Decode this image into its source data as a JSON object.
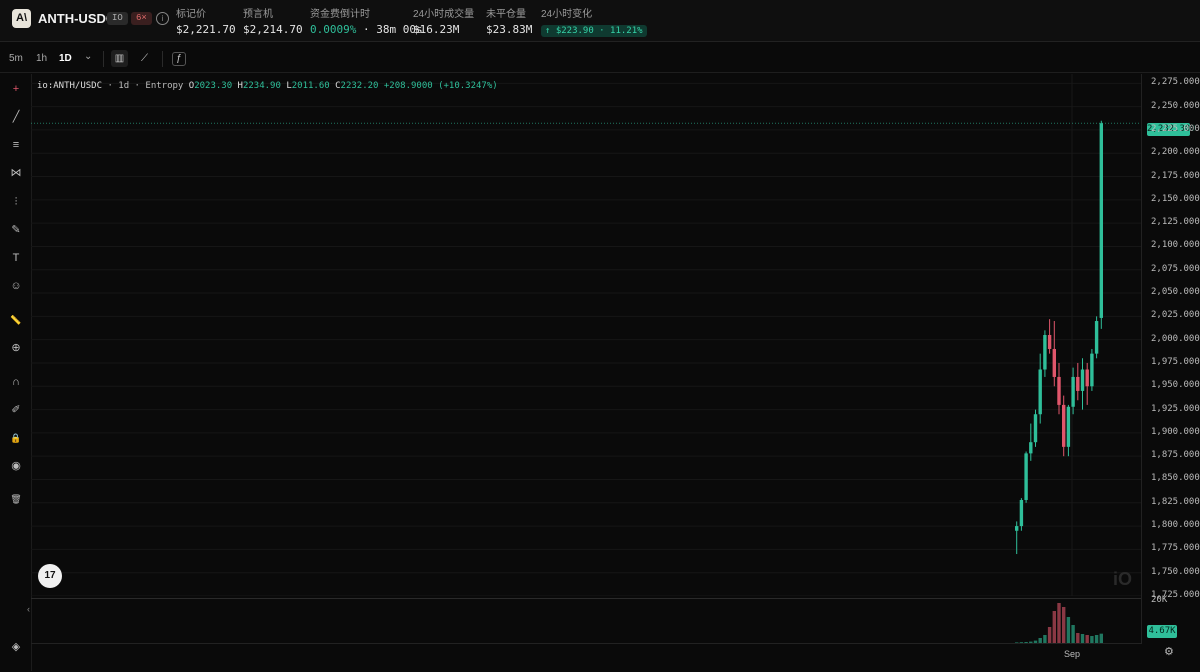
{
  "header": {
    "logo_text": "A\\",
    "pair": "ANTH-USDC",
    "venue_badge": "IO",
    "leverage_badge": "6×",
    "info_glyph": "i",
    "stats": [
      {
        "label": "标记价",
        "value": "$2,221.70"
      },
      {
        "label": "预言机",
        "value": "$2,214.70"
      },
      {
        "label": "资金费倒计时",
        "value_rate": "0.0009%",
        "value_sep": " · ",
        "value_timer": "38m 00s"
      },
      {
        "label": "24小时成交量",
        "value": "$16.23M"
      },
      {
        "label": "未平仓量",
        "value": "$23.83M"
      },
      {
        "label": "24小时变化",
        "value": "↑ $223.90 · 11.21%"
      }
    ]
  },
  "toolbar": {
    "timeframes": [
      "5m",
      "1h",
      "1D"
    ],
    "active_timeframe": "1D",
    "dropdown_glyph": "⌄",
    "icons": [
      "candles-icon",
      "line-chart-icon",
      "indicators-icon"
    ],
    "icon_glyphs": [
      "▥",
      "⟋",
      "ƒ"
    ]
  },
  "tools": [
    {
      "name": "crosshair-icon",
      "glyph": "+"
    },
    {
      "name": "trend-line-icon",
      "glyph": "╱"
    },
    {
      "name": "parallel-lines-icon",
      "glyph": "≡"
    },
    {
      "name": "pattern-icon",
      "glyph": "⋈"
    },
    {
      "name": "fib-icon",
      "glyph": "⫶"
    },
    {
      "name": "brush-icon",
      "glyph": "✎"
    },
    {
      "name": "text-icon",
      "glyph": "T"
    },
    {
      "name": "emoji-icon",
      "glyph": "☺"
    },
    {
      "name": "ruler-icon",
      "glyph": "📏"
    },
    {
      "name": "zoom-in-icon",
      "glyph": "⊕"
    },
    {
      "name": "magnet-icon",
      "glyph": "∩"
    },
    {
      "name": "lock-drawings-icon",
      "glyph": "✐"
    },
    {
      "name": "lock-icon",
      "glyph": "🔒"
    },
    {
      "name": "eye-icon",
      "glyph": "◉"
    },
    {
      "name": "trash-icon",
      "glyph": "🗑"
    }
  ],
  "legend": {
    "symbol": "io:ANTH/USDC",
    "interval": "1d",
    "source": "Entropy",
    "o_label": "O",
    "o": "2023.30",
    "h_label": "H",
    "h": "2234.90",
    "l_label": "L",
    "l": "2011.60",
    "c_label": "C",
    "c": "2232.20",
    "change": "+208.9000 (+10.3247%)"
  },
  "colors": {
    "up": "#2fbf9a",
    "down": "#e0566b",
    "bg": "#0a0a0a"
  },
  "y_ticks": [
    "2,275.000",
    "2,250.000",
    "2,225.000",
    "2,200.000",
    "2,175.000",
    "2,150.000",
    "2,125.000",
    "2,100.000",
    "2,075.000",
    "2,050.000",
    "2,025.000",
    "2,000.000",
    "1,975.000",
    "1,950.000",
    "1,925.000",
    "1,900.000",
    "1,875.000",
    "1,850.000",
    "1,825.000",
    "1,800.000",
    "1,775.000",
    "1,750.000",
    "1,725.000"
  ],
  "last_price_tag": "2,232.300",
  "volume_axis_label": "20K",
  "volume_tag": "4.67K",
  "x_label": "Sep",
  "tv_badge": "17",
  "watermark": "iO",
  "collapse_glyph": "‹",
  "settings_glyph": "⚙",
  "layers_glyph": "◈",
  "chart_data": {
    "type": "candlestick",
    "ylim": [
      1725,
      2285
    ],
    "candles": [
      {
        "o": 1795,
        "h": 1805,
        "l": 1770,
        "c": 1800
      },
      {
        "o": 1800,
        "h": 1830,
        "l": 1795,
        "c": 1828
      },
      {
        "o": 1828,
        "h": 1880,
        "l": 1825,
        "c": 1878
      },
      {
        "o": 1878,
        "h": 1910,
        "l": 1870,
        "c": 1890
      },
      {
        "o": 1890,
        "h": 1925,
        "l": 1885,
        "c": 1920
      },
      {
        "o": 1920,
        "h": 1985,
        "l": 1910,
        "c": 1968
      },
      {
        "o": 1968,
        "h": 2010,
        "l": 1960,
        "c": 2005
      },
      {
        "o": 2005,
        "h": 2022,
        "l": 1985,
        "c": 1990
      },
      {
        "o": 1990,
        "h": 2020,
        "l": 1950,
        "c": 1960
      },
      {
        "o": 1960,
        "h": 1975,
        "l": 1920,
        "c": 1930
      },
      {
        "o": 1930,
        "h": 1940,
        "l": 1875,
        "c": 1885
      },
      {
        "o": 1885,
        "h": 1930,
        "l": 1875,
        "c": 1928
      },
      {
        "o": 1928,
        "h": 1970,
        "l": 1920,
        "c": 1960
      },
      {
        "o": 1960,
        "h": 1975,
        "l": 1935,
        "c": 1945
      },
      {
        "o": 1945,
        "h": 1980,
        "l": 1925,
        "c": 1968
      },
      {
        "o": 1968,
        "h": 1975,
        "l": 1930,
        "c": 1950
      },
      {
        "o": 1950,
        "h": 1990,
        "l": 1945,
        "c": 1985
      },
      {
        "o": 1985,
        "h": 2025,
        "l": 1980,
        "c": 2020
      },
      {
        "o": 2023.3,
        "h": 2234.9,
        "l": 2011.6,
        "c": 2232.2
      }
    ],
    "volumes": [
      300,
      400,
      500,
      700,
      1200,
      2500,
      4000,
      8000,
      16000,
      20000,
      18000,
      13000,
      9000,
      5000,
      4500,
      4000,
      3500,
      4000,
      4670
    ],
    "volume_ylim": [
      0,
      20000
    ]
  }
}
